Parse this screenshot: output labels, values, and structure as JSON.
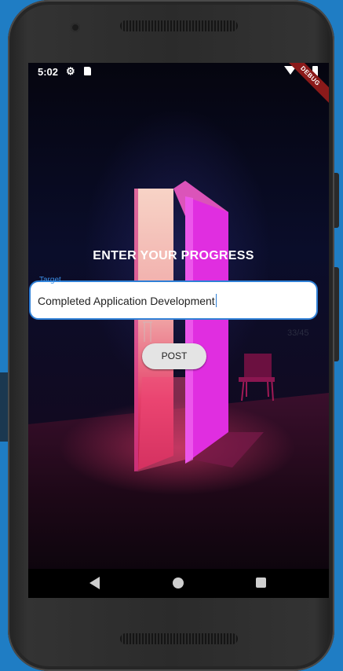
{
  "status_bar": {
    "time": "5:02",
    "icons": [
      "gear-icon",
      "sd-card-icon",
      "wifi-icon",
      "battery-icon"
    ]
  },
  "debug_banner": "DEBUG",
  "page": {
    "title": "ENTER YOUR PROGRESS"
  },
  "target_field": {
    "label": "Target",
    "value": "Completed Application Development",
    "counter": "33/45"
  },
  "post_button": {
    "label": "POST"
  },
  "nav_bar": {
    "icons": [
      "back-icon",
      "home-icon",
      "recents-icon"
    ]
  },
  "colors": {
    "accent": "#2f80d6",
    "background_desktop": "#1f7dc4",
    "button_bg": "#e4e4e4"
  }
}
